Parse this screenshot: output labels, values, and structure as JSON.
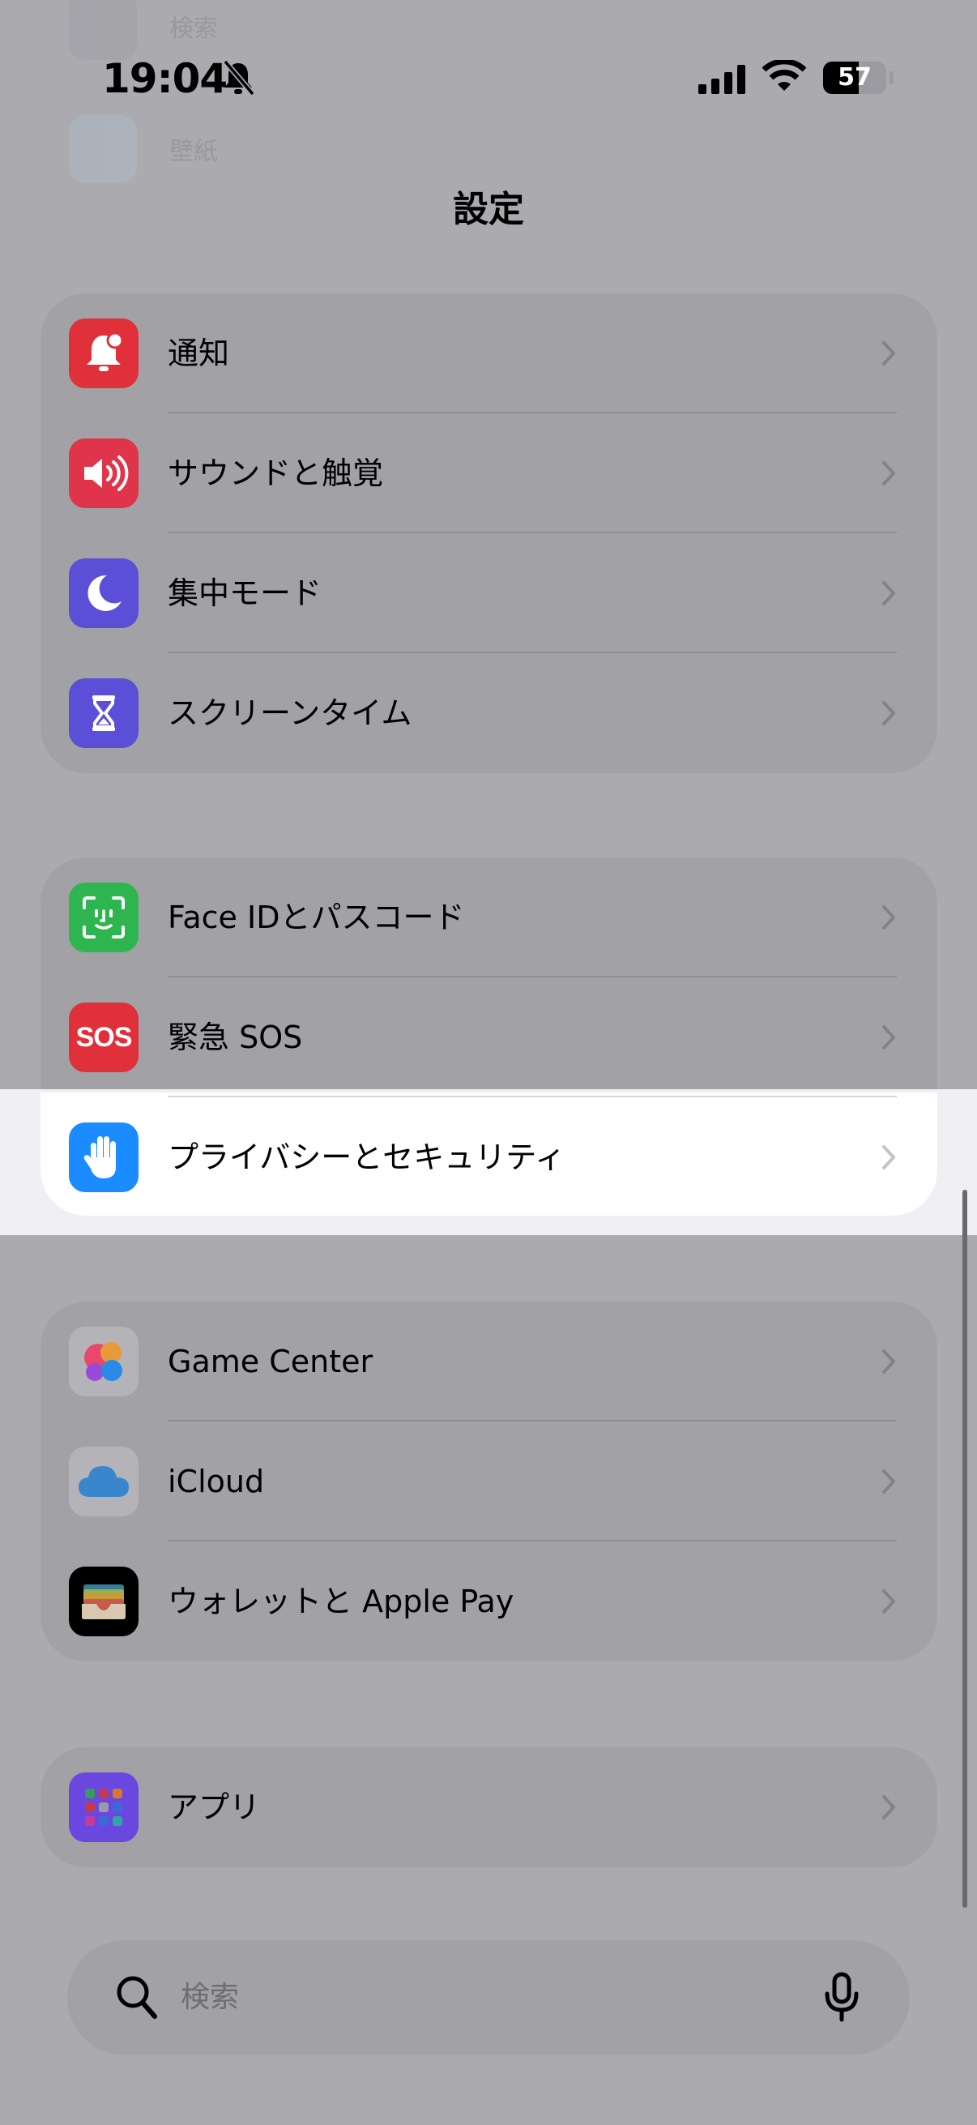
{
  "status_bar": {
    "time": "19:04",
    "battery": "57",
    "battery_level": 0.57,
    "icons": [
      "bell-slash-icon",
      "cellular-signal-icon",
      "wifi-icon",
      "battery-icon"
    ]
  },
  "nav": {
    "title": "設定"
  },
  "groups": [
    {
      "items": [
        {
          "label": "通知",
          "icon": "bell-badge-icon",
          "color": "#e0303a"
        },
        {
          "label": "サウンドと触覚",
          "icon": "speaker-wave-icon",
          "color": "#e0344a"
        },
        {
          "label": "集中モード",
          "icon": "moon-icon",
          "color": "#5b4fd8"
        },
        {
          "label": "スクリーンタイム",
          "icon": "hourglass-icon",
          "color": "#5a4fd6"
        }
      ]
    },
    {
      "items": [
        {
          "label": "Face IDとパスコード",
          "icon": "face-id-icon",
          "color": "#2fb550"
        },
        {
          "label": "緊急 SOS",
          "icon": "sos-icon",
          "icon_text": "SOS",
          "color": "#e0303a"
        },
        {
          "label": "プライバシーとセキュリティ",
          "icon": "hand-raised-icon",
          "color": "#1a8cff",
          "highlighted": true
        }
      ]
    },
    {
      "items": [
        {
          "label": "Game Center",
          "icon": "game-center-icon",
          "color": "#ffffff"
        },
        {
          "label": "iCloud",
          "icon": "icloud-icon",
          "color": "#ffffff"
        },
        {
          "label": "ウォレットと Apple Pay",
          "icon": "wallet-icon",
          "color": "#000000"
        }
      ]
    },
    {
      "items": [
        {
          "label": "アプリ",
          "icon": "app-grid-icon",
          "color": "#6a48e0"
        }
      ]
    }
  ],
  "search": {
    "placeholder": "検索",
    "icons": [
      "search-icon",
      "microphone-icon"
    ]
  }
}
